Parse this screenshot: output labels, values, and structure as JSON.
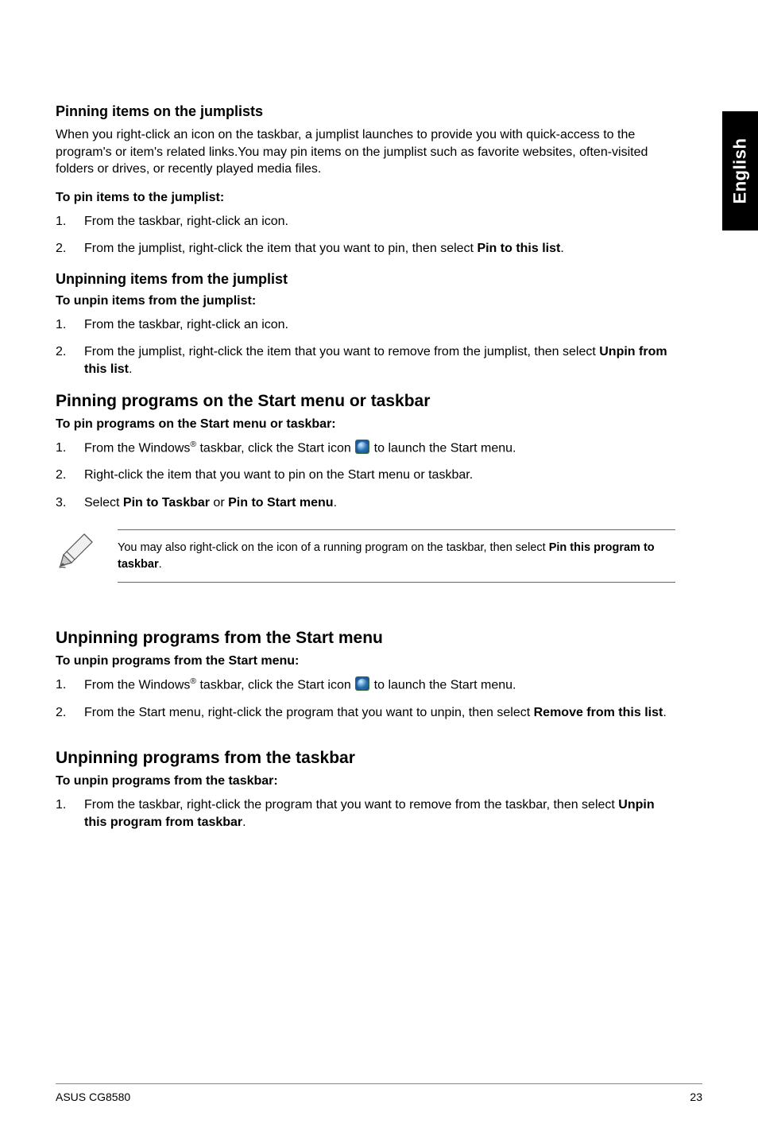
{
  "sideTab": "English",
  "sec1": {
    "heading": "Pinning items on the jumplists",
    "intro": "When you right-click an icon on the taskbar, a jumplist launches to provide you with quick-access to the program's or item's related links.You may pin items on the jumplist such as favorite websites, often-visited folders or drives, or recently played media files.",
    "sub": "To pin items to the jumplist:",
    "step1": {
      "num": "1.",
      "text": "From the taskbar, right-click an icon."
    },
    "step2": {
      "num": "2.",
      "pre": "From the jumplist, right-click the item that you want to pin, then select ",
      "bold": "Pin to this list",
      "post": "."
    }
  },
  "sec2": {
    "heading": "Unpinning items from the jumplist",
    "sub": "To unpin items from the jumplist:",
    "step1": {
      "num": "1.",
      "text": "From the taskbar, right-click an icon."
    },
    "step2": {
      "num": "2.",
      "pre": "From the jumplist, right-click the item that you want to remove from the jumplist, then select ",
      "bold": "Unpin from this list",
      "post": "."
    }
  },
  "sec3": {
    "heading": "Pinning programs on the Start menu or taskbar",
    "sub": "To pin programs on the Start menu or taskbar:",
    "step1": {
      "num": "1.",
      "pre": "From the Windows",
      "reg": "®",
      "mid": " taskbar, click the Start icon ",
      "post": " to launch the Start menu."
    },
    "step2": {
      "num": "2.",
      "text": "Right-click the item that you want to pin on the Start menu or taskbar."
    },
    "step3": {
      "num": "3.",
      "pre": "Select ",
      "b1": "Pin to Taskbar",
      "mid": " or ",
      "b2": "Pin to Start menu",
      "post": "."
    }
  },
  "note": {
    "pre": "You may also right-click on the icon of a running program on the taskbar, then select ",
    "bold": "Pin this program to taskbar",
    "post": "."
  },
  "sec4": {
    "heading": "Unpinning programs from the Start menu",
    "sub": "To unpin programs from the Start menu:",
    "step1": {
      "num": "1.",
      "pre": "From the Windows",
      "reg": "®",
      "mid": " taskbar, click the Start icon ",
      "post": " to launch the Start menu."
    },
    "step2": {
      "num": "2.",
      "pre": "From the Start menu, right-click the program that you want to unpin, then select ",
      "bold": "Remove from this list",
      "post": "."
    }
  },
  "sec5": {
    "heading": "Unpinning programs from the taskbar",
    "sub": "To unpin programs from the taskbar:",
    "step1": {
      "num": "1.",
      "pre": "From the taskbar, right-click the program that you want to remove from the taskbar, then select ",
      "bold": "Unpin this program from taskbar",
      "post": "."
    }
  },
  "footer": {
    "left": "ASUS CG8580",
    "right": "23"
  }
}
